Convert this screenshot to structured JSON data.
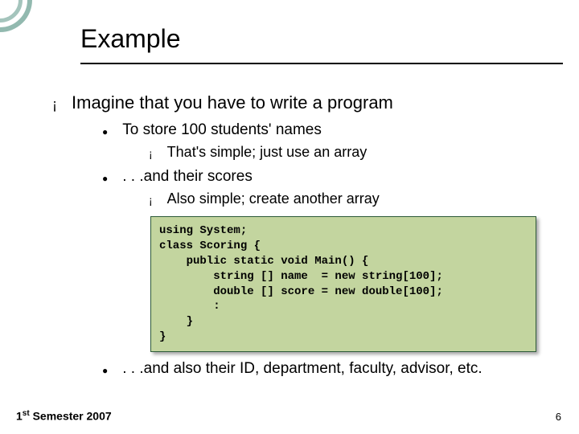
{
  "title": "Example",
  "bullets": {
    "main": "Imagine that you have to write a program",
    "b1": "To store 100 students' names",
    "b1a": "That's simple; just use an array",
    "b2": ". . .and their scores",
    "b2a": "Also simple; create another array",
    "b3": ". . .and also their ID, department, faculty, advisor, etc."
  },
  "code": "using System;\nclass Scoring {\n    public static void Main() {\n        string [] name  = new string[100];\n        double [] score = new double[100];\n        :\n    }\n}",
  "footer_prefix": "1",
  "footer_sup": "st",
  "footer_rest": " Semester 2007",
  "page_number": "6"
}
